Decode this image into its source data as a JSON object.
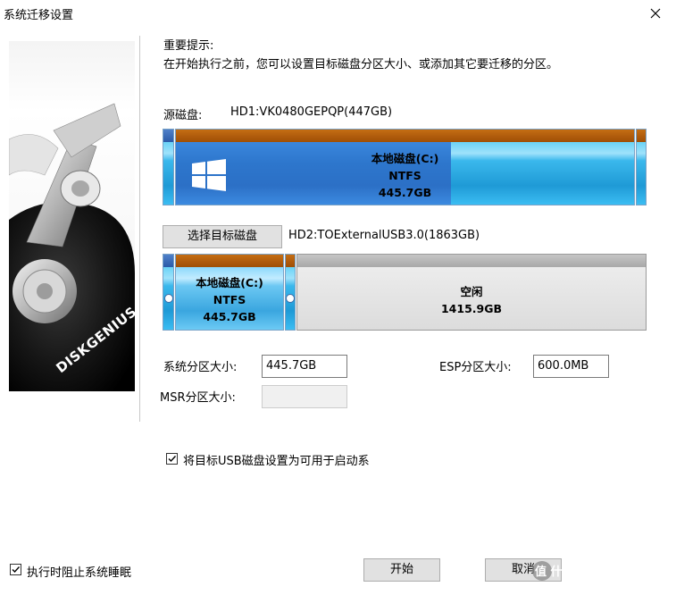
{
  "window": {
    "title": "系统迁移设置"
  },
  "notice": {
    "heading": "重要提示:",
    "text": "在开始执行之前，您可以设置目标磁盘分区大小、或添加其它要迁移的分区。"
  },
  "source": {
    "label": "源磁盘:",
    "disk": "HD1:VK0480GEPQP(447GB)",
    "partition": {
      "name": "本地磁盘(C:)",
      "fs": "NTFS",
      "size": "445.7GB",
      "used_fraction": 0.6
    }
  },
  "target": {
    "select_button": "选择目标磁盘",
    "disk": "HD2:TOExternalUSB3.0(1863GB)",
    "partition": {
      "name": "本地磁盘(C:)",
      "fs": "NTFS",
      "size": "445.7GB"
    },
    "free": {
      "name": "空闲",
      "size": "1415.9GB"
    }
  },
  "sizes": {
    "system_label": "系统分区大小:",
    "system_value": "445.7GB",
    "esp_label": "ESP分区大小:",
    "esp_value": "600.0MB",
    "msr_label": "MSR分区大小:",
    "msr_value": ""
  },
  "options": {
    "usb_bootable": {
      "label": "将目标USB磁盘设置为可用于启动系",
      "checked": true
    },
    "prevent_sleep": {
      "label": "执行时阻止系统睡眠",
      "checked": true
    }
  },
  "buttons": {
    "start": "开始",
    "cancel": "取消"
  },
  "side_image": {
    "brand": "DISKGENIUS"
  },
  "watermark": {
    "text": "值 什么值得买"
  },
  "colors": {
    "partition_top": "#a85507",
    "partition_body": "#3ab8ec",
    "used_fill": "#2d76cc",
    "free_space": "#dcdcdc"
  }
}
